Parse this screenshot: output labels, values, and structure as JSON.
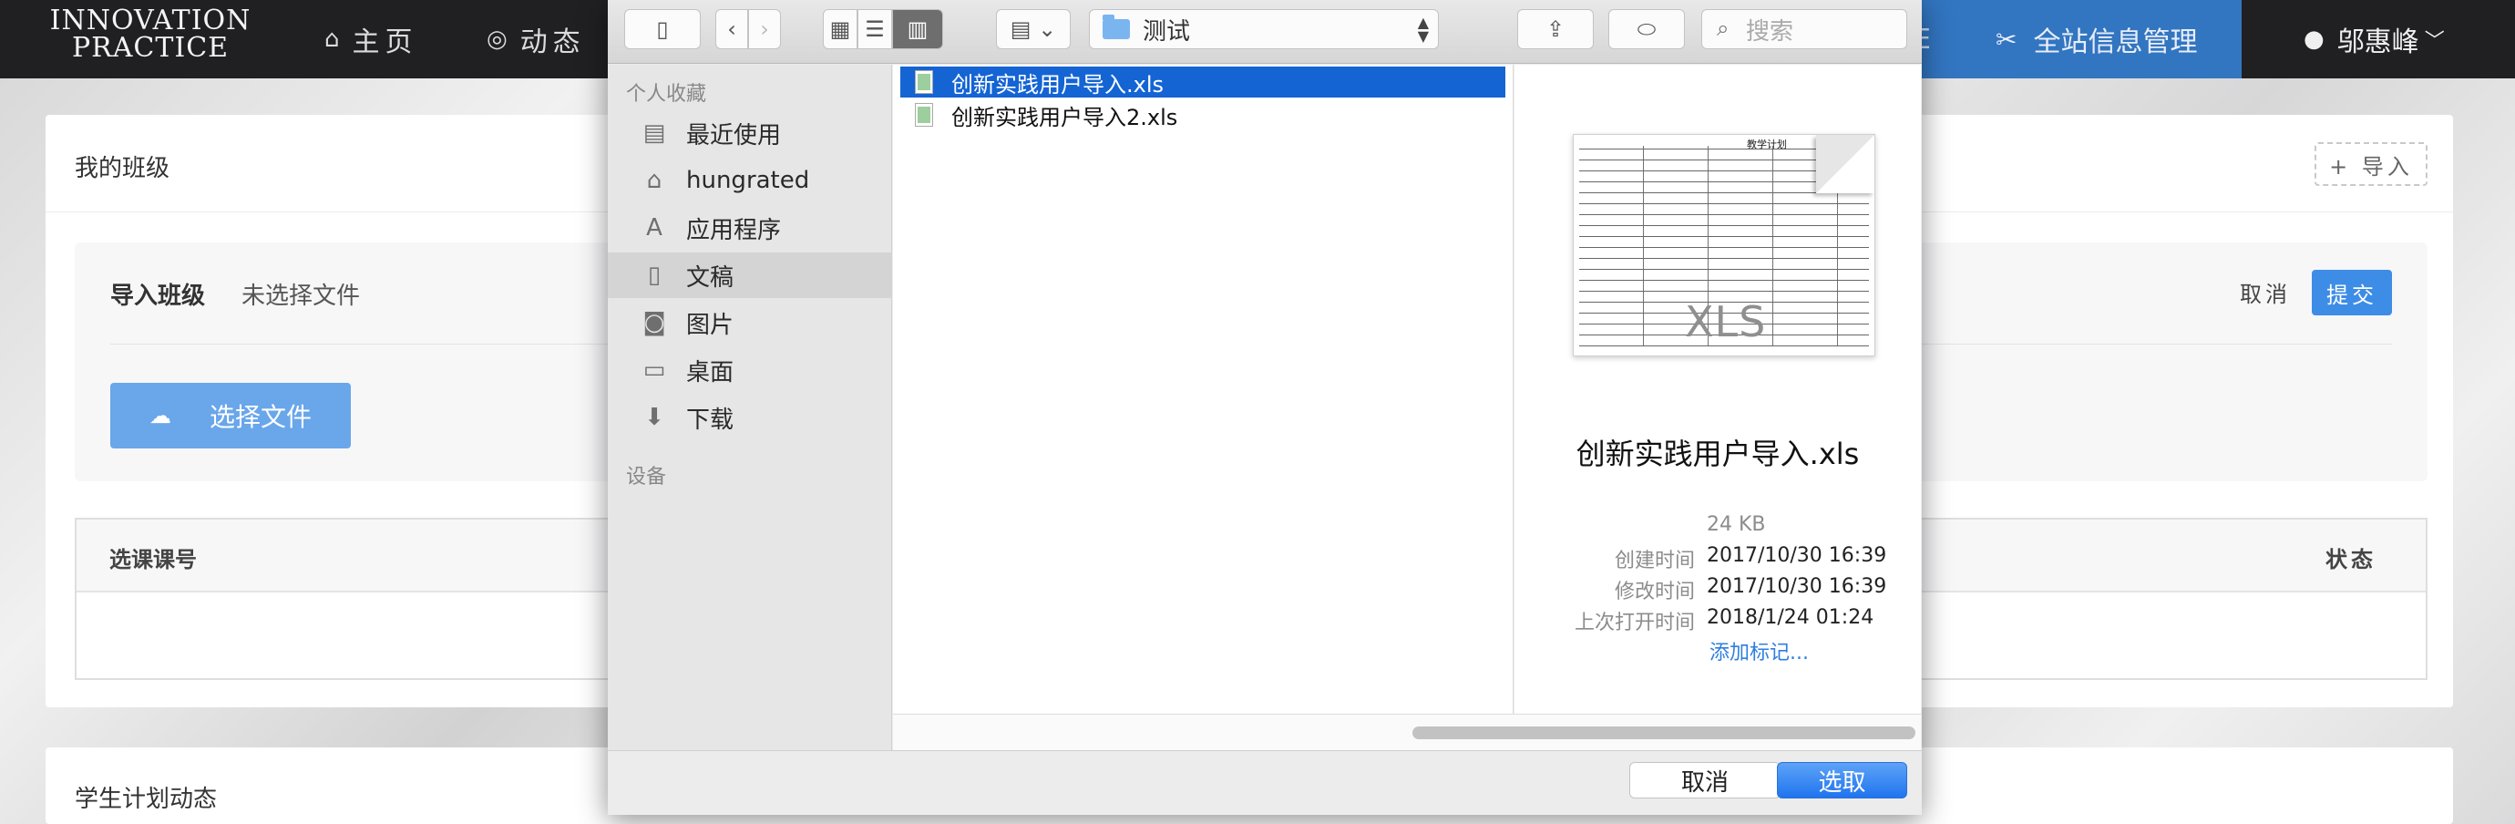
{
  "site": {
    "logo_line1": "INNOVATION",
    "logo_line2": "PRACTICE",
    "nav": {
      "home": "主页",
      "dynamic": "动态",
      "partial_left": "E",
      "site_mgmt": "全站信息管理",
      "user_name": "邬惠峰"
    },
    "class_card": {
      "title": "我的班级",
      "import_label": "+ 导入",
      "import_class_label": "导入班级",
      "no_file_text": "未选择文件",
      "cancel_label": "取消",
      "submit_label": "提交",
      "choose_file_label": "选择文件",
      "table_col_course": "选课课号",
      "table_col_status": "状态"
    },
    "plan_card": {
      "title": "学生计划动态"
    }
  },
  "dialog": {
    "path": "测试",
    "search_placeholder": "搜索",
    "sidebar": {
      "favorites_header": "个人收藏",
      "devices_header": "设备",
      "items": [
        {
          "label": "最近使用",
          "icon": "recents-icon"
        },
        {
          "label": "hungrated",
          "icon": "home-icon"
        },
        {
          "label": "应用程序",
          "icon": "applications-icon"
        },
        {
          "label": "文稿",
          "icon": "documents-icon",
          "selected": true
        },
        {
          "label": "图片",
          "icon": "camera-icon"
        },
        {
          "label": "桌面",
          "icon": "desktop-icon"
        },
        {
          "label": "下载",
          "icon": "download-icon"
        }
      ]
    },
    "files": [
      {
        "name": "创新实践用户导入.xls",
        "selected": true
      },
      {
        "name": "创新实践用户导入2.xls",
        "selected": false
      }
    ],
    "preview": {
      "thumb_label": "XLS",
      "thumb_header": "教学计划",
      "name": "创新实践用户导入.xls",
      "size": "24 KB",
      "created_label": "创建时间",
      "created": "2017/10/30 16:39",
      "modified_label": "修改时间",
      "modified": "2017/10/30 16:39",
      "opened_label": "上次打开时间",
      "opened": "2018/1/24 01:24",
      "add_tag": "添加标记..."
    },
    "footer": {
      "cancel_label": "取消",
      "choose_label": "选取"
    }
  }
}
